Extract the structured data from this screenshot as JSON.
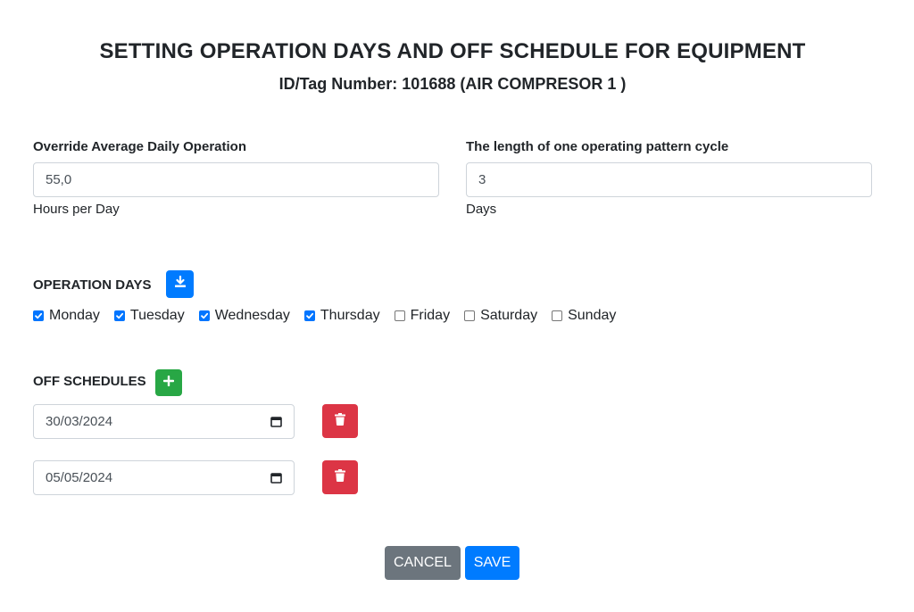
{
  "header": {
    "title": "SETTING OPERATION DAYS AND OFF SCHEDULE FOR EQUIPMENT",
    "subtitle": "ID/Tag Number: 101688 (AIR COMPRESOR 1 )"
  },
  "override": {
    "label": "Override Average Daily Operation",
    "value": "55,0",
    "unit": "Hours per Day"
  },
  "cycle": {
    "label": "The length of one operating pattern cycle",
    "value": "3",
    "unit": "Days"
  },
  "operation_days": {
    "label": "OPERATION DAYS",
    "download_icon": "download-icon",
    "days": [
      {
        "label": "Monday",
        "checked": true
      },
      {
        "label": "Tuesday",
        "checked": true
      },
      {
        "label": "Wednesday",
        "checked": true
      },
      {
        "label": "Thursday",
        "checked": true
      },
      {
        "label": "Friday",
        "checked": false
      },
      {
        "label": "Saturday",
        "checked": false
      },
      {
        "label": "Sunday",
        "checked": false
      }
    ]
  },
  "off_schedules": {
    "label": "OFF SCHEDULES",
    "add_icon": "plus-icon",
    "dates": [
      {
        "value": "30/03/2024"
      },
      {
        "value": "05/05/2024"
      }
    ]
  },
  "actions": {
    "cancel_label": "CANCEL",
    "save_label": "SAVE"
  },
  "colors": {
    "primary": "#007bff",
    "success": "#28a745",
    "danger": "#dc3545",
    "secondary": "#6c757d"
  }
}
